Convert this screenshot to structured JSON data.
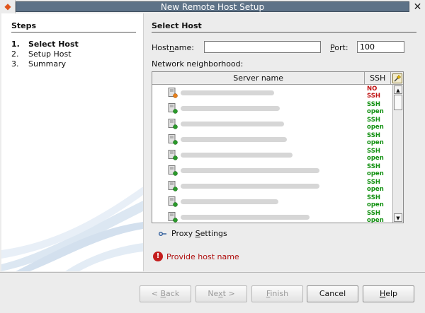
{
  "window": {
    "title": "New Remote Host Setup",
    "app_icon": "netbeans-icon",
    "close_glyph": "✕"
  },
  "steps": {
    "title": "Steps",
    "items": [
      {
        "num": "1.",
        "label": "Select Host",
        "active": true
      },
      {
        "num": "2.",
        "label": "Setup Host",
        "active": false
      },
      {
        "num": "3.",
        "label": "Summary",
        "active": false
      }
    ]
  },
  "main": {
    "title": "Select Host",
    "hostname_label_pre": "Host",
    "hostname_label_mnemonic": "n",
    "hostname_label_post": "ame:",
    "hostname_value": "",
    "port_label_mnemonic": "P",
    "port_label_post": "ort:",
    "port_value": "100",
    "network_label": "Network neighborhood:"
  },
  "table": {
    "col_server": "Server name",
    "col_ssh": "SSH",
    "refresh_icon": "refresh-search-icon",
    "rows": [
      {
        "ssh_line1": "NO",
        "ssh_line2": "SSH",
        "status": "no"
      },
      {
        "ssh_line1": "SSH",
        "ssh_line2": "open",
        "status": "ok"
      },
      {
        "ssh_line1": "SSH",
        "ssh_line2": "open",
        "status": "ok"
      },
      {
        "ssh_line1": "SSH",
        "ssh_line2": "open",
        "status": "ok"
      },
      {
        "ssh_line1": "SSH",
        "ssh_line2": "open",
        "status": "ok"
      },
      {
        "ssh_line1": "SSH",
        "ssh_line2": "open",
        "status": "ok"
      },
      {
        "ssh_line1": "SSH",
        "ssh_line2": "open",
        "status": "ok"
      },
      {
        "ssh_line1": "SSH",
        "ssh_line2": "open",
        "status": "ok"
      },
      {
        "ssh_line1": "SSH",
        "ssh_line2": "open",
        "status": "ok"
      }
    ]
  },
  "proxy": {
    "label_pre": "Proxy ",
    "label_mnemonic": "S",
    "label_post": "ettings"
  },
  "error": {
    "message": "Provide host name",
    "icon": "error-icon"
  },
  "buttons": {
    "back": "< Back",
    "next": "Next >",
    "finish": "Finish",
    "cancel": "Cancel",
    "help": "Help"
  },
  "colors": {
    "title_bar": "#5d7287",
    "ssh_open": "#119010",
    "ssh_no": "#c01010",
    "error": "#b01010"
  }
}
